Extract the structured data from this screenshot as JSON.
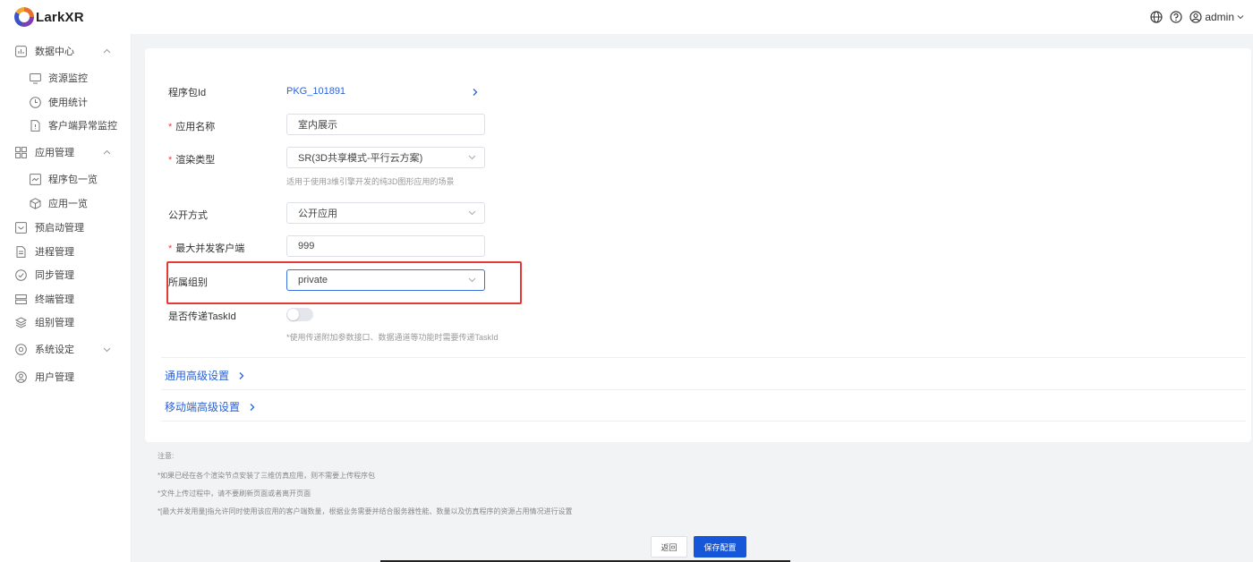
{
  "header": {
    "logo_text": "LarkXR",
    "user": "admin",
    "icons": [
      "globe-icon",
      "help-icon",
      "user-icon"
    ]
  },
  "sidebar": {
    "items": [
      {
        "label": "数据中心",
        "icon": "chart-icon",
        "expanded": true
      },
      {
        "label": "资源监控",
        "icon": "monitor-icon",
        "sub": true
      },
      {
        "label": "使用统计",
        "icon": "clock-icon",
        "sub": true
      },
      {
        "label": "客户端异常监控",
        "icon": "document-icon",
        "sub": true
      },
      {
        "label": "应用管理",
        "icon": "grid-icon",
        "expanded": true
      },
      {
        "label": "程序包一览",
        "icon": "package-icon",
        "sub": true
      },
      {
        "label": "应用一览",
        "icon": "cube-icon",
        "sub": true
      },
      {
        "label": "预启动管理",
        "icon": "inbox-icon"
      },
      {
        "label": "进程管理",
        "icon": "file-icon"
      },
      {
        "label": "同步管理",
        "icon": "check-circle-icon"
      },
      {
        "label": "终端管理",
        "icon": "terminal-icon"
      },
      {
        "label": "组别管理",
        "icon": "layers-icon"
      },
      {
        "label": "系统设定",
        "icon": "settings-icon",
        "expanded": false
      },
      {
        "label": "用户管理",
        "icon": "user-circle-icon"
      }
    ]
  },
  "form": {
    "package_id": {
      "label": "程序包Id",
      "value": "PKG_101891"
    },
    "app_name": {
      "label": "应用名称",
      "value": "室内展示"
    },
    "render_type": {
      "label": "渲染类型",
      "value": "SR(3D共享模式-平行云方案)",
      "hint": "适用于使用3维引擎开发的纯3D图形应用的场景"
    },
    "publish_mode": {
      "label": "公开方式",
      "value": "公开应用"
    },
    "max_clients": {
      "label": "最大并发客户端",
      "value": "999"
    },
    "group": {
      "label": "所属组别",
      "value": "private"
    },
    "pass_taskid": {
      "label": "是否传递TaskId",
      "hint": "*使用传递附加参数接口、数据通道等功能时需要传递TaskId",
      "enabled": false
    },
    "advanced_general": "通用高级设置",
    "advanced_mobile": "移动端高级设置"
  },
  "notes": {
    "title": "注意:",
    "lines": [
      "*如果已经在各个渲染节点安装了三维仿真应用，则不需要上传程序包",
      "*文件上传过程中，请不要刷新页面或者离开页面",
      "*[最大并发用量]指允许同时使用该应用的客户端数量，根据业务需要并结合服务器性能、数量以及仿真程序的资源占用情况进行设置"
    ]
  },
  "buttons": {
    "back": "返回",
    "save": "保存配置"
  },
  "colors": {
    "accent": "#1657d9",
    "link": "#2a62d5",
    "required": "#f04134",
    "highlight": "#e53935"
  }
}
